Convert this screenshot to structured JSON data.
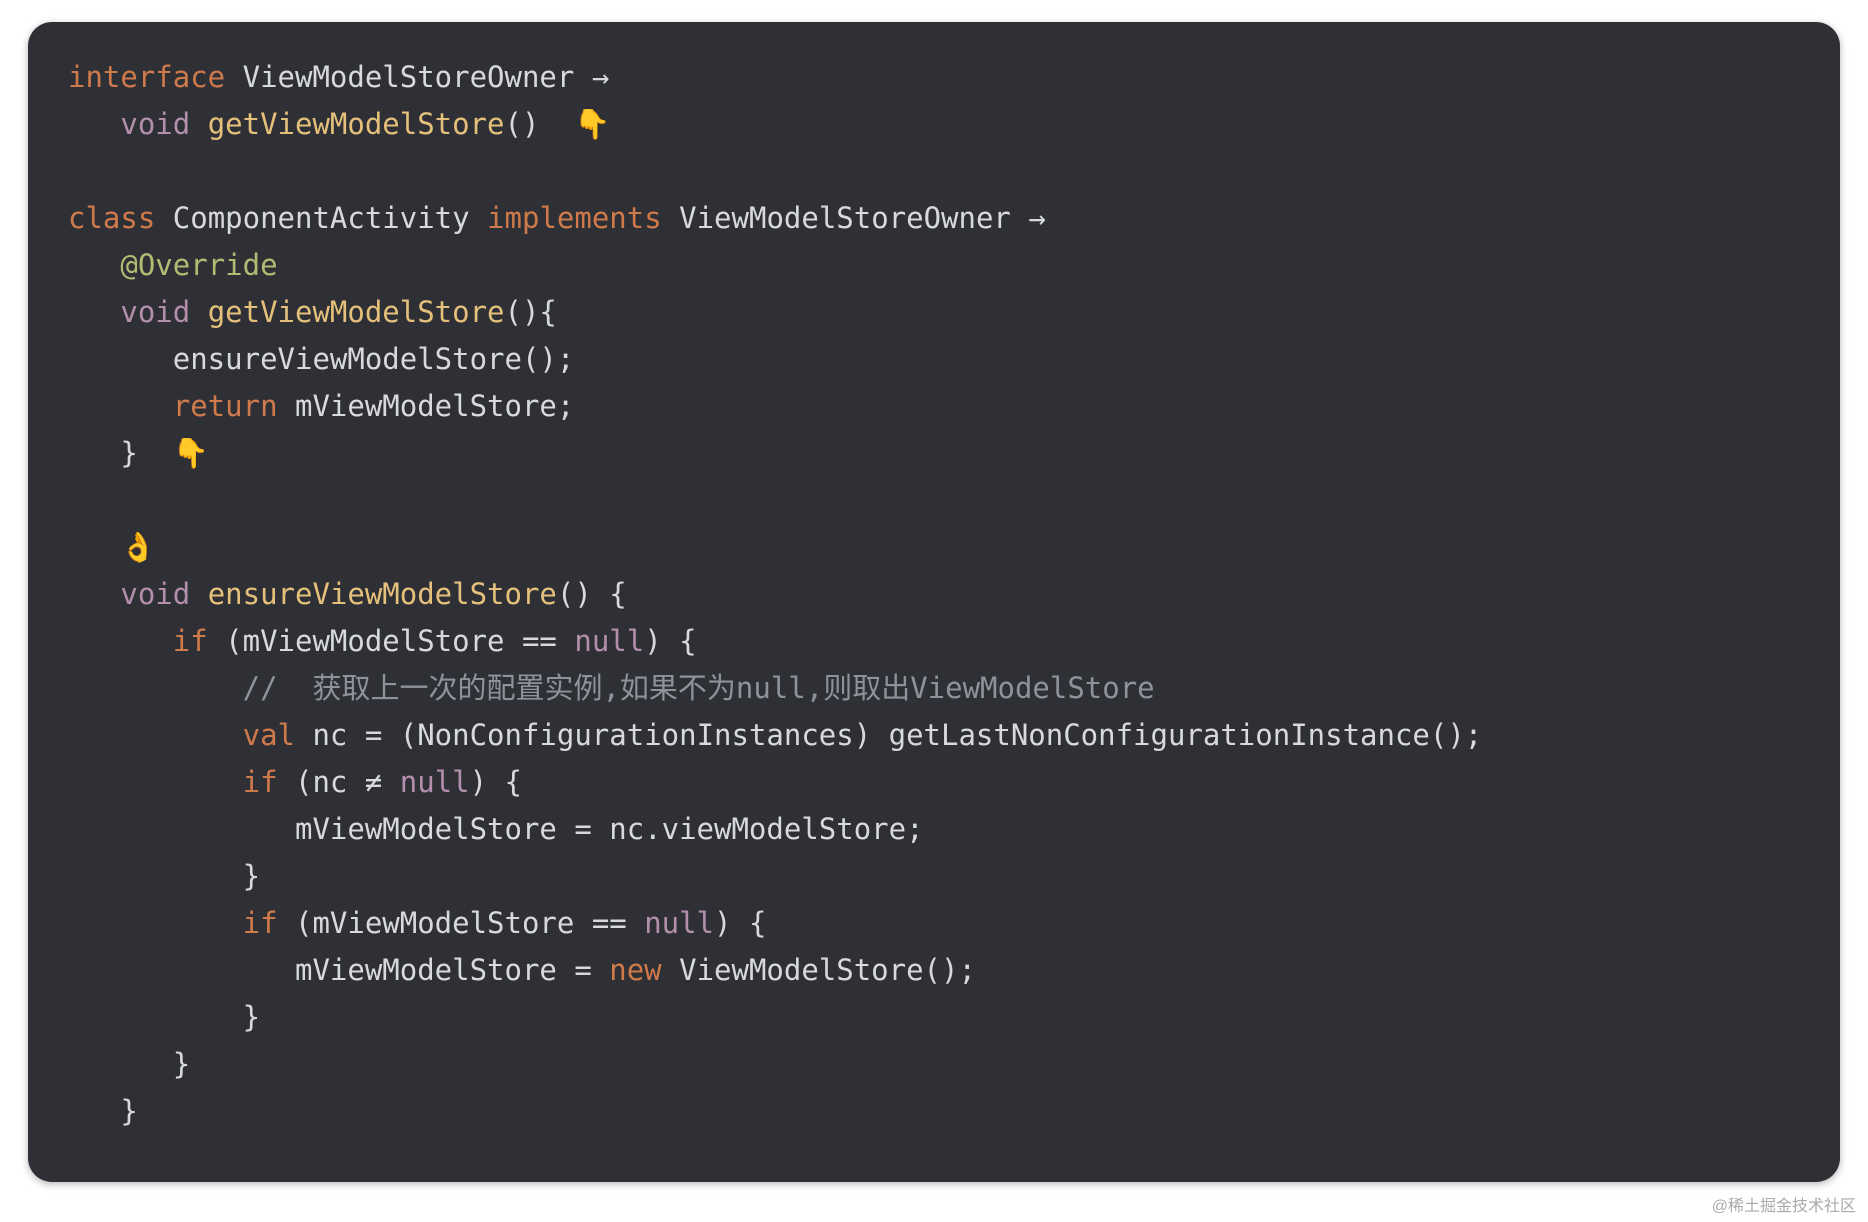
{
  "colors": {
    "bg": "#2e3036",
    "keyword": "#cf7a4a",
    "type": "#b48ead",
    "function": "#e5c07b",
    "annotation": "#b2bb72",
    "text": "#d7d9df",
    "comment": "#8f9399"
  },
  "watermark": "@稀土掘金技术社区",
  "emoji": {
    "point_down": "👇",
    "ok": "👌"
  },
  "code": {
    "l1": {
      "kw": "interface",
      "name": "ViewModelStoreOwner",
      "arrow": "→"
    },
    "l2": {
      "ret": "void",
      "fn": "getViewModelStore",
      "paren": "()"
    },
    "l4": {
      "kw1": "class",
      "name": "ComponentActivity",
      "kw2": "implements",
      "iface": "ViewModelStoreOwner",
      "arrow": "→"
    },
    "l5": {
      "ann": "@Override"
    },
    "l6": {
      "ret": "void",
      "fn": "getViewModelStore",
      "open": "(){"
    },
    "l7": {
      "call": "ensureViewModelStore();"
    },
    "l8": {
      "kw": "return",
      "var": "mViewModelStore;"
    },
    "l9": {
      "brace": "}"
    },
    "l12": {
      "ret": "void",
      "fn": "ensureViewModelStore",
      "open": "() {"
    },
    "l13": {
      "kw": "if",
      "open": "(mViewModelStore ",
      "eq": "==",
      "sp": " ",
      "nul": "null",
      "close": ") {"
    },
    "l14": {
      "cmt": "//  获取上一次的配置实例,如果不为null,则取出ViewModelStore"
    },
    "l15": {
      "kw": "val",
      "rest": " nc = (NonConfigurationInstances) getLastNonConfigurationInstance();"
    },
    "l16": {
      "kw": "if",
      "open": "(nc ",
      "ne": "≠",
      "sp": " ",
      "nul": "null",
      "close": ") {"
    },
    "l17": {
      "stmt": "mViewModelStore = nc.viewModelStore;"
    },
    "l18": {
      "brace": "}"
    },
    "l19": {
      "kw": "if",
      "open": "(mViewModelStore ",
      "eq": "==",
      "sp": " ",
      "nul": "null",
      "close": ") {"
    },
    "l20": {
      "lhs": "mViewModelStore = ",
      "kw": "new",
      "rhs": " ViewModelStore();"
    },
    "l21": {
      "brace": "}"
    },
    "l22": {
      "brace": "}"
    },
    "l23": {
      "brace": "}"
    }
  }
}
